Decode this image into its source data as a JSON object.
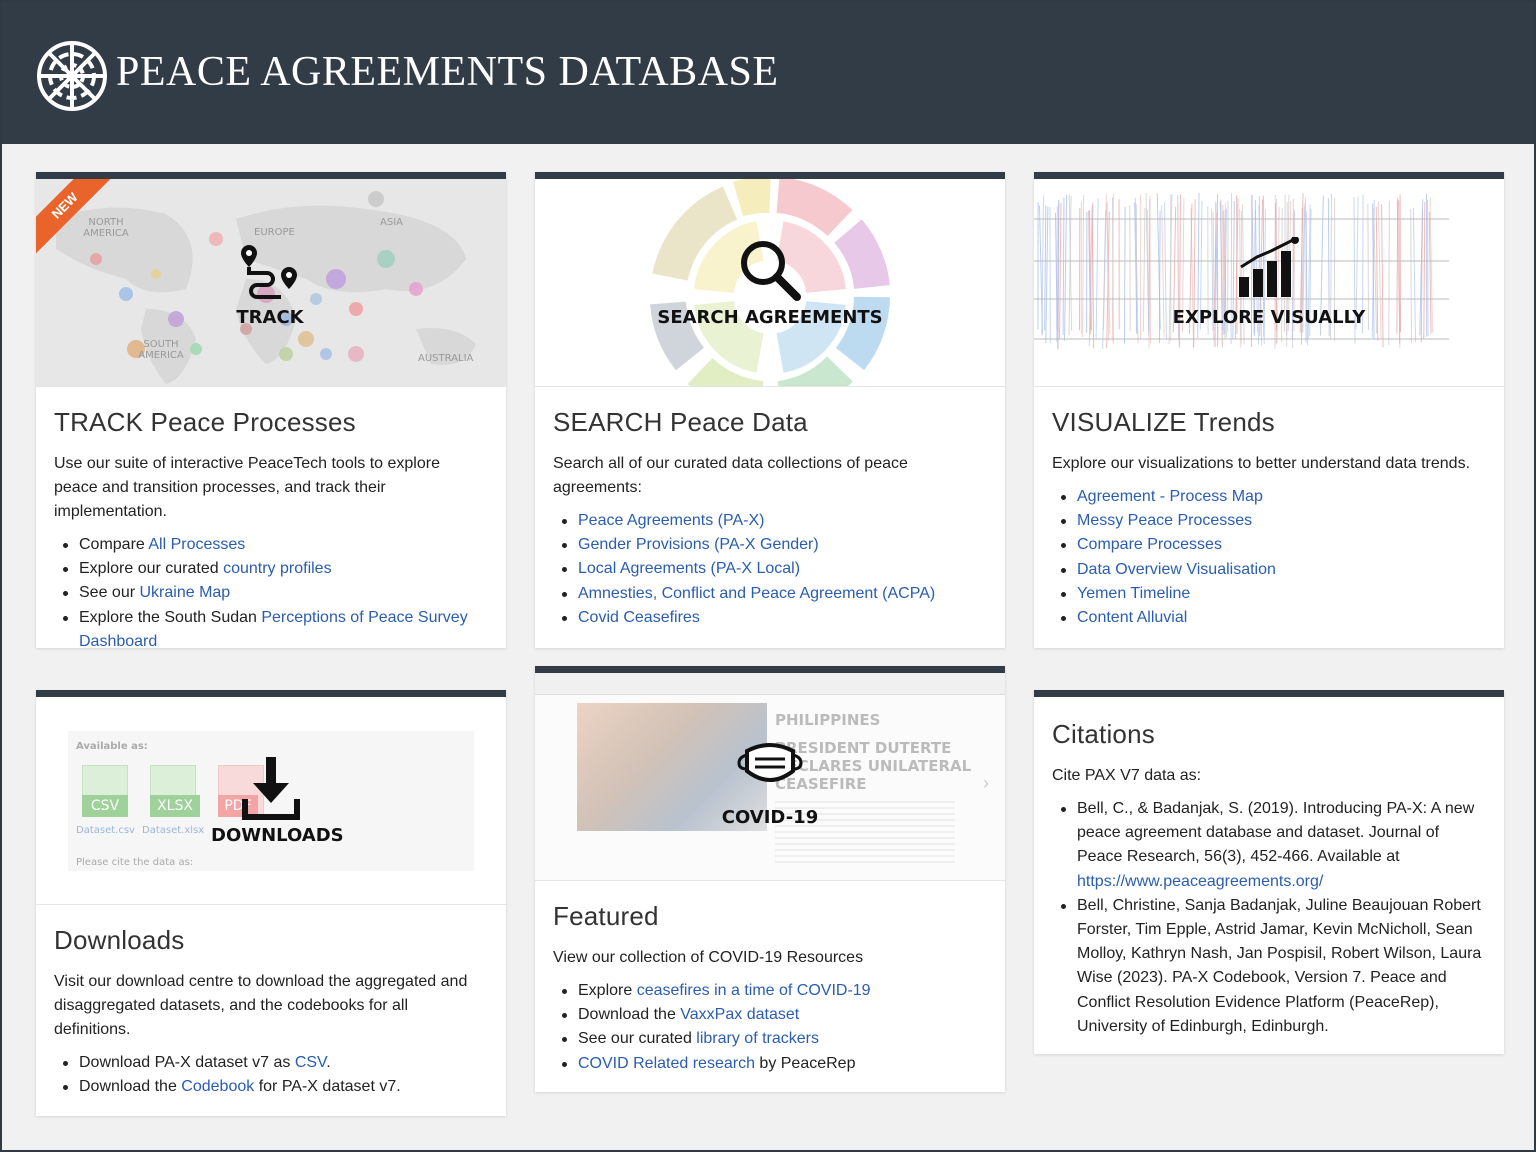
{
  "header": {
    "title": "PEACE AGREEMENTS DATABASE",
    "logo_icon": "pax-wheel-logo"
  },
  "cards": {
    "track": {
      "badge": "NEW",
      "overlay_label": "TRACK",
      "map_labels": [
        "NORTH AMERICA",
        "EUROPE",
        "ASIA",
        "SOUTH AMERICA",
        "AUSTRALIA"
      ],
      "title": "TRACK Peace Processes",
      "desc": "Use our suite of interactive PeaceTech tools to explore peace and transition processes, and track their implementation.",
      "items": [
        {
          "pre": "Compare ",
          "link": "All Processes",
          "post": ""
        },
        {
          "pre": "Explore our curated ",
          "link": "country profiles",
          "post": ""
        },
        {
          "pre": "See our ",
          "link": "Ukraine Map",
          "post": ""
        },
        {
          "pre": "Explore the South Sudan ",
          "link": "Perceptions of Peace Survey Dashboard",
          "post": ""
        }
      ]
    },
    "search": {
      "overlay_label": "SEARCH AGREEMENTS",
      "title": "SEARCH Peace Data",
      "desc": "Search all of our curated data collections of peace agreements:",
      "items": [
        {
          "link": "Peace Agreements (PA-X)"
        },
        {
          "link": "Gender Provisions (PA-X Gender)"
        },
        {
          "link": "Local Agreements (PA-X Local)"
        },
        {
          "link": "Amnesties, Conflict and Peace Agreement (ACPA)"
        },
        {
          "link": "Covid Ceasefires"
        }
      ]
    },
    "visualize": {
      "overlay_label": "EXPLORE VISUALLY",
      "title": "VISUALIZE Trends",
      "desc": "Explore our visualizations to better understand data trends.",
      "items": [
        {
          "link": "Agreement - Process Map"
        },
        {
          "link": "Messy Peace Processes"
        },
        {
          "link": "Compare Processes"
        },
        {
          "link": "Data Overview Visualisation"
        },
        {
          "link": "Yemen Timeline"
        },
        {
          "link": "Content Alluvial"
        }
      ]
    },
    "downloads": {
      "overlay_label": "DOWNLOADS",
      "available_label": "Available as:",
      "formats": [
        "CSV",
        "XLSX",
        "PDF"
      ],
      "file_names": [
        "Dataset.csv",
        "Dataset.xlsx"
      ],
      "cite_text": "Please cite the data as:",
      "title": "Downloads",
      "desc": "Visit our download centre to download the aggregated and disaggregated datasets, and the codebooks for all definitions.",
      "items": [
        {
          "pre": "Download PA-X dataset v7 as ",
          "link": "CSV",
          "post": "."
        },
        {
          "pre": "Download the ",
          "link": "Codebook",
          "post": " for PA-X dataset v7."
        }
      ]
    },
    "featured": {
      "overlay_label": "COVID-19",
      "news_country": "PHILIPPINES",
      "news_headline": "PRESIDENT DUTERTE DECLARES UNILATERAL CEASEFIRE",
      "title": "Featured",
      "desc": "View our collection of COVID-19 Resources",
      "items": [
        {
          "pre": "Explore ",
          "link": "ceasefires in a time of COVID-19",
          "post": ""
        },
        {
          "pre": "Download the ",
          "link": "VaxxPax dataset",
          "post": ""
        },
        {
          "pre": "See our curated ",
          "link": "library of trackers",
          "post": ""
        },
        {
          "pre": "",
          "link": "COVID Related research",
          "post": " by PeaceRep"
        }
      ]
    },
    "citations": {
      "title": "Citations",
      "desc": "Cite PAX V7 data as:",
      "cite1_text": "Bell, C., & Badanjak, S. (2019). Introducing PA-X: A new peace agreement database and dataset. Journal of Peace Research, 56(3), 452-466. Available at ",
      "cite1_link": "https://www.peaceagreements.org/",
      "cite2_text": "Bell, Christine, Sanja Badanjak, Juline Beaujouan Robert Forster, Tim Epple, Astrid Jamar, Kevin McNicholl, Sean Molloy, Kathryn Nash, Jan Pospisil, Robert Wilson, Laura Wise (2023). PA-X Codebook, Version 7. Peace and Conflict Resolution Evidence Platform (PeaceRep), University of Edinburgh, Edinburgh."
    }
  },
  "colors": {
    "header_bg": "#323c46",
    "link": "#2a5db0",
    "ribbon": "#e8642a"
  }
}
